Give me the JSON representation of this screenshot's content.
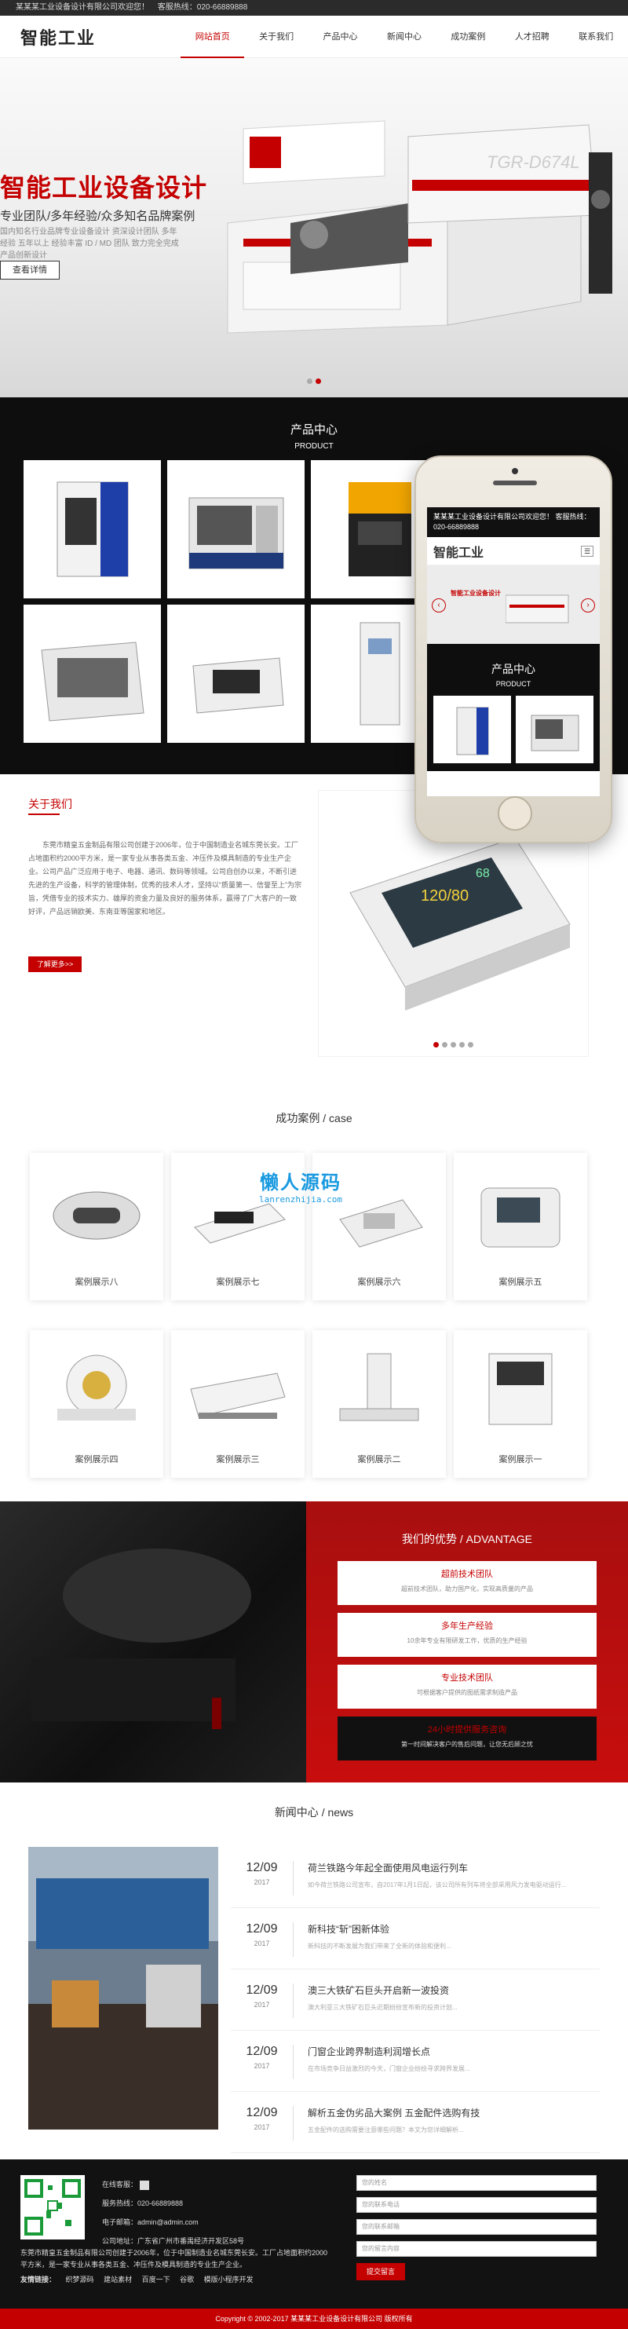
{
  "topbar": {
    "welcome": "某某某工业设备设计有限公司欢迎您！",
    "hotline": "客服热线：020-66889888"
  },
  "header": {
    "logo": "智能工业",
    "menu": [
      {
        "label": "网站首页",
        "active": true
      },
      {
        "label": "关于我们",
        "active": false
      },
      {
        "label": "产品中心",
        "active": false
      },
      {
        "label": "新闻中心",
        "active": false
      },
      {
        "label": "成功案例",
        "active": false
      },
      {
        "label": "人才招聘",
        "active": false
      },
      {
        "label": "联系我们",
        "active": false
      }
    ]
  },
  "hero": {
    "title": "智能工业设备设计",
    "subtitle": "专业团队/多年经验/众多知名品牌案例",
    "desc": "国内知名行业品牌专业设备设计 资深设计团队 多年经验 五年以上 经验丰富 ID / MD 团队 致力完全完成产品创新设计",
    "button": "查看详情",
    "machine_text": "TGR-D674L"
  },
  "products": {
    "title": "产品中心",
    "subtitle": "PRODUCT"
  },
  "phone": {
    "top": "某某某工业设备设计有限公司欢迎您！ 客服热线：020-66889888",
    "logo": "智能工业",
    "banner_label": "智能工业设备设计",
    "product_title": "产品中心",
    "product_sub": "PRODUCT"
  },
  "about": {
    "title": "关于我们",
    "text": "东莞市精皇五金制品有限公司创建于2006年，位于中国制造业名城东莞长安。工厂占地面积约2000平方米，是一家专业从事各类五金、冲压件及模具制造的专业生产企业。公司产品广泛应用于电子、电器、通讯、数码等领域。公司自创办以来，不断引进先进的生产设备，科学的管理体制，优秀的技术人才，坚持以“质量第一、信誉至上”为宗旨，凭借专业的技术实力、雄厚的资金力量及良好的服务体系，赢得了广大客户的一致好评，产品远销欧美、东南亚等国家和地区。",
    "button": "了解更多>>"
  },
  "cases": {
    "title": "成功案例 / case",
    "items": [
      "案例展示八",
      "案例展示七",
      "案例展示六",
      "案例展示五",
      "案例展示四",
      "案例展示三",
      "案例展示二",
      "案例展示一"
    ]
  },
  "watermark": {
    "cn": "懒人源码",
    "en": "lanrenzhijia.com"
  },
  "advantage": {
    "title": "我们的优势 / ADVANTAGE",
    "items": [
      {
        "title": "超前技术团队",
        "desc": "超前技术团队，助力国产化，实现高质量的产品"
      },
      {
        "title": "多年生产经验",
        "desc": "10余年专业有限研发工作，优质的生产经验"
      },
      {
        "title": "专业技术团队",
        "desc": "可根据客户提供的图纸需求制造产品"
      },
      {
        "title": "24小时提供服务咨询",
        "desc": "第一时间解决客户的售后问题，让您无后顾之忧"
      }
    ]
  },
  "news": {
    "title": "新闻中心 / news",
    "items": [
      {
        "day": "12/09",
        "year": "2017",
        "title": "荷兰铁路今年起全面使用风电运行列车",
        "excerpt": "如今荷兰铁路公司宣布，自2017年1月1日起，该公司所有列车将全部采用风力发电驱动运行..."
      },
      {
        "day": "12/09",
        "year": "2017",
        "title": "新科技“斩”困新体验",
        "excerpt": "新科技的不断发展为我们带来了全新的体验和便利..."
      },
      {
        "day": "12/09",
        "year": "2017",
        "title": "澳三大铁矿石巨头开启新一波投资",
        "excerpt": "澳大利亚三大铁矿石巨头近期纷纷宣布新的投资计划..."
      },
      {
        "day": "12/09",
        "year": "2017",
        "title": "门窗企业跨界制造利润增长点",
        "excerpt": "在市场竞争日益激烈的今天，门窗企业纷纷寻求跨界发展..."
      },
      {
        "day": "12/09",
        "year": "2017",
        "title": "解析五金伪劣品大案例 五金配件选购有技",
        "excerpt": "五金配件的选购需要注意哪些问题？本文为您详细解析..."
      }
    ]
  },
  "footer": {
    "online": "在线客服：",
    "phone": "服务热线：020-66889888",
    "email": "电子邮箱：admin@admin.com",
    "address": "公司地址：广东省广州市番禺经济开发区58号",
    "desc": "东莞市精皇五金制品有限公司创建于2006年，位于中国制造业名城东莞长安。工厂占地面积约2000平方米，是一家专业从事各类五金、冲压件及模具制造的专业生产企业。",
    "links_label": "友情链接：",
    "links": [
      "织梦源码",
      "建站素材",
      "百度一下",
      "谷歌",
      "模版小程序开发"
    ],
    "form": {
      "name": "您的姓名",
      "phone": "您的联系电话",
      "email": "您的联系邮箱",
      "message": "您的留言内容",
      "submit": "提交留言"
    },
    "copyright": "Copyright © 2002-2017 某某某工业设备设计有限公司 版权所有"
  },
  "colors": {
    "accent": "#c40000",
    "dark": "#0e0e0e"
  }
}
